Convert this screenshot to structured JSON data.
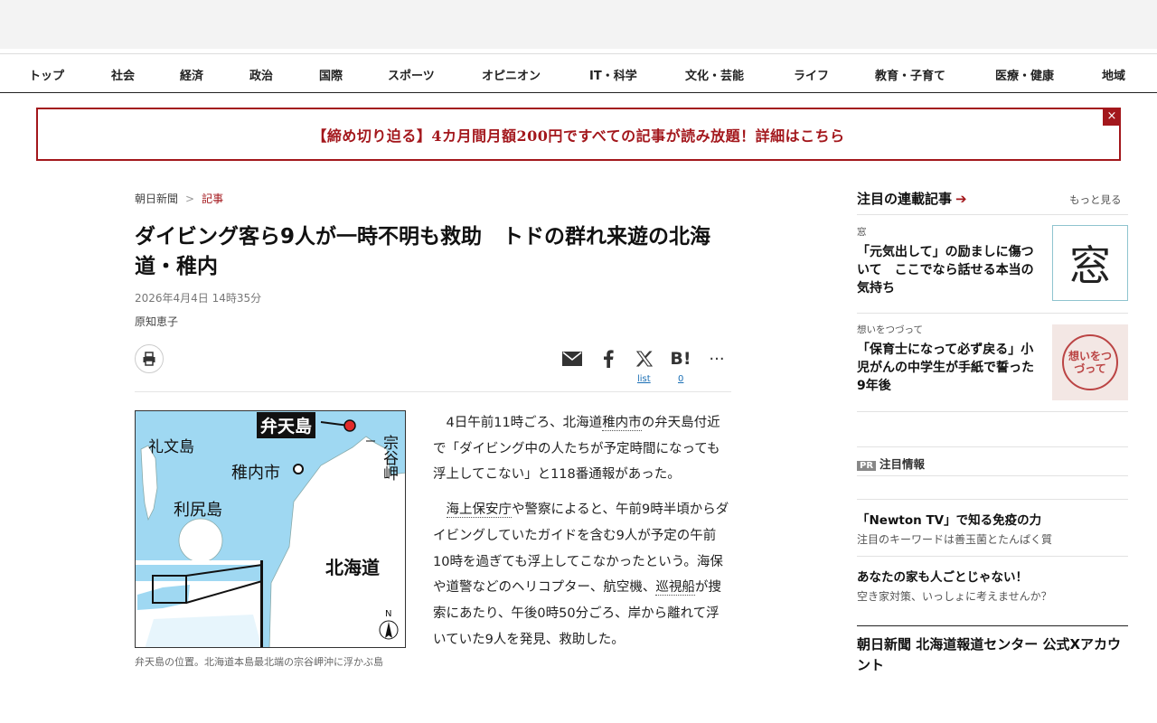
{
  "nav": [
    "トップ",
    "社会",
    "経済",
    "政治",
    "国際",
    "スポーツ",
    "オピニオン",
    "IT・科学",
    "文化・芸能",
    "ライフ",
    "教育・子育て",
    "医療・健康",
    "地域"
  ],
  "banner": {
    "text": "【締め切り迫る】4カ月間月額200円ですべての記事が読み放題！詳細はこちら",
    "close": "×"
  },
  "breadcrumb": {
    "home": "朝日新聞",
    "sep": ">",
    "current": "記事"
  },
  "article": {
    "title": "ダイビング客ら9人が一時不明も救助　トドの群れ来遊の北海道・稚内",
    "date": "2026年4月4日 14時35分",
    "author": "原知恵子",
    "share": {
      "list_label": "list",
      "hatena_count": "0"
    },
    "map": {
      "labels": {
        "bentenjima": "弁天島",
        "rebun": "礼文島",
        "wakkanai": "稚内市",
        "rishiri": "利尻島",
        "soya": "宗谷岬",
        "hokkaido": "北海道",
        "north": "N"
      }
    },
    "caption": "弁天島の位置。北海道本島最北端の宗谷岬沖に浮かぶ島",
    "p1": {
      "a": "4日午前11時ごろ、北海道",
      "b": "稚内市",
      "c": "の弁天島付近で「ダイビング中の人たちが予定時間になっても浮上してこない」と118番通報があった。"
    },
    "p2": {
      "a": "海上保安庁",
      "b": "や警察によると、午前9時半頃からダイビングしていたガイドを含む9人が予定の午前10時を過ぎても浮上してこなかったという。海保や道警などのヘリコプター、航空機、",
      "c": "巡視船",
      "d": "が捜索にあたり、午後0時50分ごろ、岸から離れて浮いていた9人を発見、救助した。"
    }
  },
  "sidebar": {
    "head": "注目の連載記事",
    "more": "もっと見る",
    "items": [
      {
        "label": "窓",
        "title": "「元気出して」の励ましに傷ついて　ここでなら話せる本当の気持ち",
        "thumb_text": "窓"
      },
      {
        "label": "想いをつづって",
        "title": "「保育士になって必ず戻る」小児がんの中学生が手紙で誓った9年後",
        "thumb_text": "想いをつづって"
      }
    ],
    "pr_badge": "PR",
    "pr_head": "注目情報",
    "pr_items": [
      {
        "title": "「Newton TV」で知る免疫の力",
        "sub": "注目のキーワードは善玉菌とたんぱく質"
      },
      {
        "title": "あなたの家も人ごとじゃない！",
        "sub": "空き家対策、いっしょに考えませんか？"
      }
    ],
    "x_head": "朝日新聞 北海道報道センター 公式Xアカウント"
  },
  "colors": {
    "accent": "#a3171c",
    "sea": "#9fd8f2",
    "land": "#ffffff"
  },
  "icons": [
    "print-icon",
    "mail-icon",
    "facebook-icon",
    "x-icon",
    "hatena-icon",
    "more-icon",
    "arrow-right-icon",
    "close-icon"
  ]
}
